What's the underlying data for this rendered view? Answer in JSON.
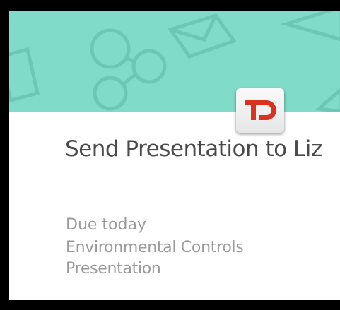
{
  "card": {
    "app_badge": "TD",
    "title": "Send Presentation to Liz",
    "due": "Due today",
    "project": "Environmental Controls Presentation"
  },
  "colors": {
    "banner": "#80dcc9",
    "badge_text": "#d9331f",
    "title_text": "#4a4a4a",
    "subtext": "#9a9a9a"
  },
  "icons": {
    "banner": [
      "share-icon",
      "envelope-icon"
    ],
    "badge": "todoist-logo-icon"
  }
}
